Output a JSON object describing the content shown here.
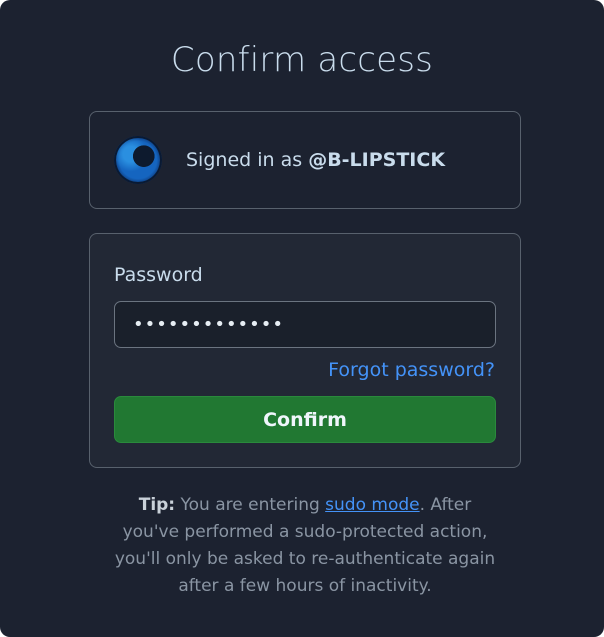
{
  "page": {
    "title": "Confirm access"
  },
  "account": {
    "signed_in_prefix": "Signed in as",
    "username": "@B-LIPSTICK"
  },
  "form": {
    "password_label": "Password",
    "password_value": "•••••••••••••",
    "forgot_link": "Forgot password?",
    "confirm_button": "Confirm"
  },
  "tip": {
    "label": "Tip:",
    "text_before_link": "You are entering",
    "link_text": "sudo mode",
    "text_after_link": ". After you've performed a sudo-protected action, you'll only be asked to re-authenticate again after a few hours of inactivity."
  },
  "colors": {
    "background": "#1c2230",
    "accent_link": "#4493f8",
    "confirm_button": "#217832"
  }
}
